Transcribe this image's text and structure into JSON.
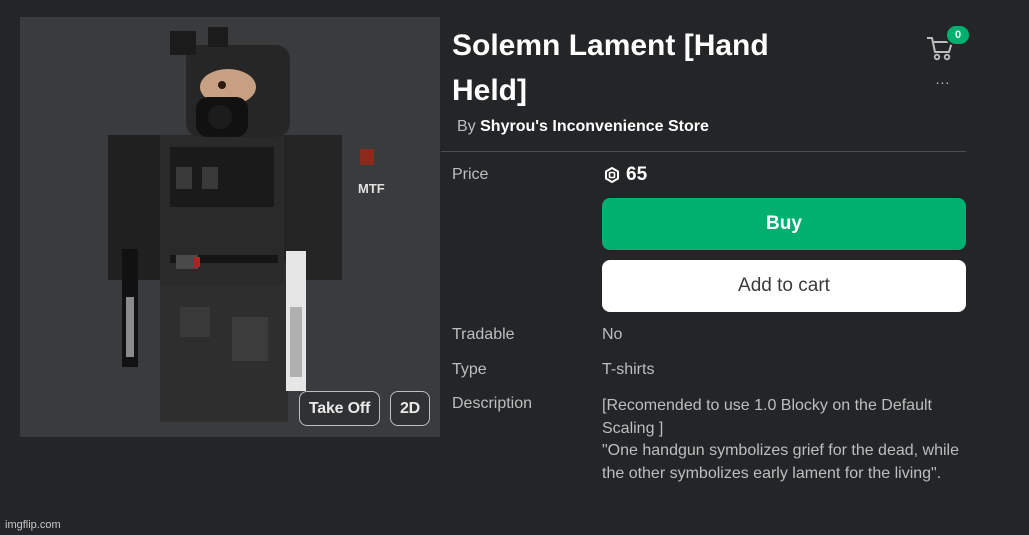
{
  "item": {
    "title_line1": "Solemn Lament [Hand",
    "title_line2": "Held]",
    "by_label": "By",
    "creator": "Shyrou's Inconvenience Store"
  },
  "cart": {
    "count": "0"
  },
  "more_menu": "...",
  "preview": {
    "take_off_label": "Take Off",
    "toggle_2d_label": "2D",
    "vest_patch_text": "MTF"
  },
  "details": {
    "price_label": "Price",
    "price_value": "65",
    "currency_icon": "robux-icon",
    "buy_label": "Buy",
    "add_to_cart_label": "Add to cart",
    "tradable_label": "Tradable",
    "tradable_value": "No",
    "type_label": "Type",
    "type_value": "T-shirts",
    "description_label": "Description",
    "description_lines": [
      "[Recomended to use 1.0 Blocky on the Default Scaling ]",
      "\"One handgun symbolizes grief for the dead, while the other symbolizes early lament for the living\"."
    ]
  },
  "watermark": "imgflip.com",
  "colors": {
    "background": "#232527",
    "preview_bg": "#393b3d",
    "buy_green": "#00b06f",
    "text_muted": "#bdbebe"
  }
}
